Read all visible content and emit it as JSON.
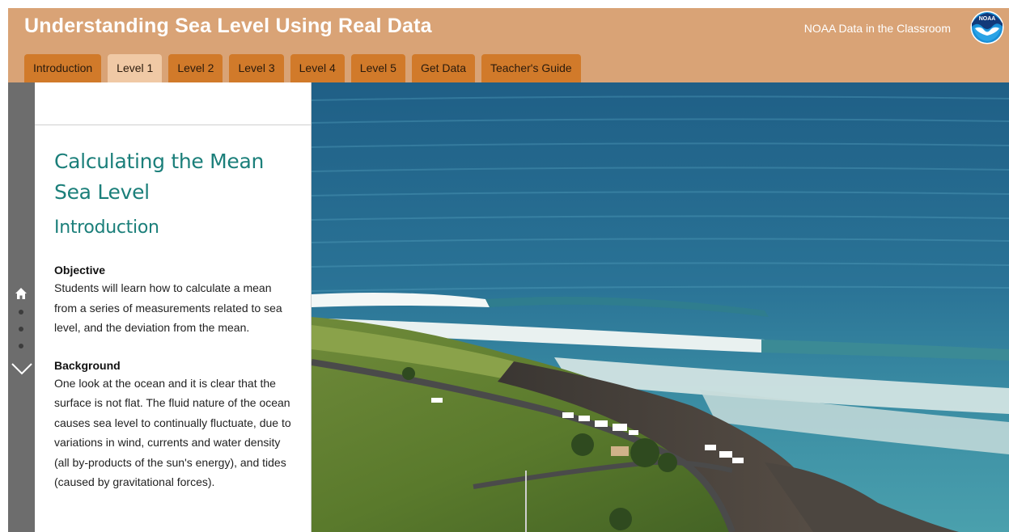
{
  "header": {
    "title": "Understanding Sea Level Using Real Data",
    "brand": "NOAA Data in the Classroom",
    "logo_text": "NOAA"
  },
  "tabs": [
    {
      "label": "Introduction",
      "active": false
    },
    {
      "label": "Level 1",
      "active": true
    },
    {
      "label": "Level 2",
      "active": false
    },
    {
      "label": "Level 3",
      "active": false
    },
    {
      "label": "Level 4",
      "active": false
    },
    {
      "label": "Level 5",
      "active": false
    },
    {
      "label": "Get Data",
      "active": false
    },
    {
      "label": "Teacher's Guide",
      "active": false
    }
  ],
  "rail": {
    "icons": [
      "home-icon",
      "chevron-down-icon"
    ],
    "dots": 3
  },
  "panel": {
    "title": "Calculating the Mean Sea Level",
    "section": "Introduction",
    "objective_heading": "Objective",
    "objective_text": "Students will learn how to calculate a mean from a series of measurements related to sea level, and the deviation from the mean.",
    "background_heading": "Background",
    "background_text": "One look at the ocean and it is clear that the surface is not flat. The fluid nature of the ocean causes sea level to continually fluctuate, due to variations in wind, currents and water density (all by-products of the sun's energy), and tides (caused by gravitational forces)."
  },
  "colors": {
    "header_bg": "#d9a376",
    "tab_bg": "#d17a2a",
    "tab_active_bg": "#f0c9a5",
    "heading_teal": "#1b7f7a",
    "rail_bg": "#6d6d6d",
    "noaa_blue": "#1a8fd6"
  }
}
